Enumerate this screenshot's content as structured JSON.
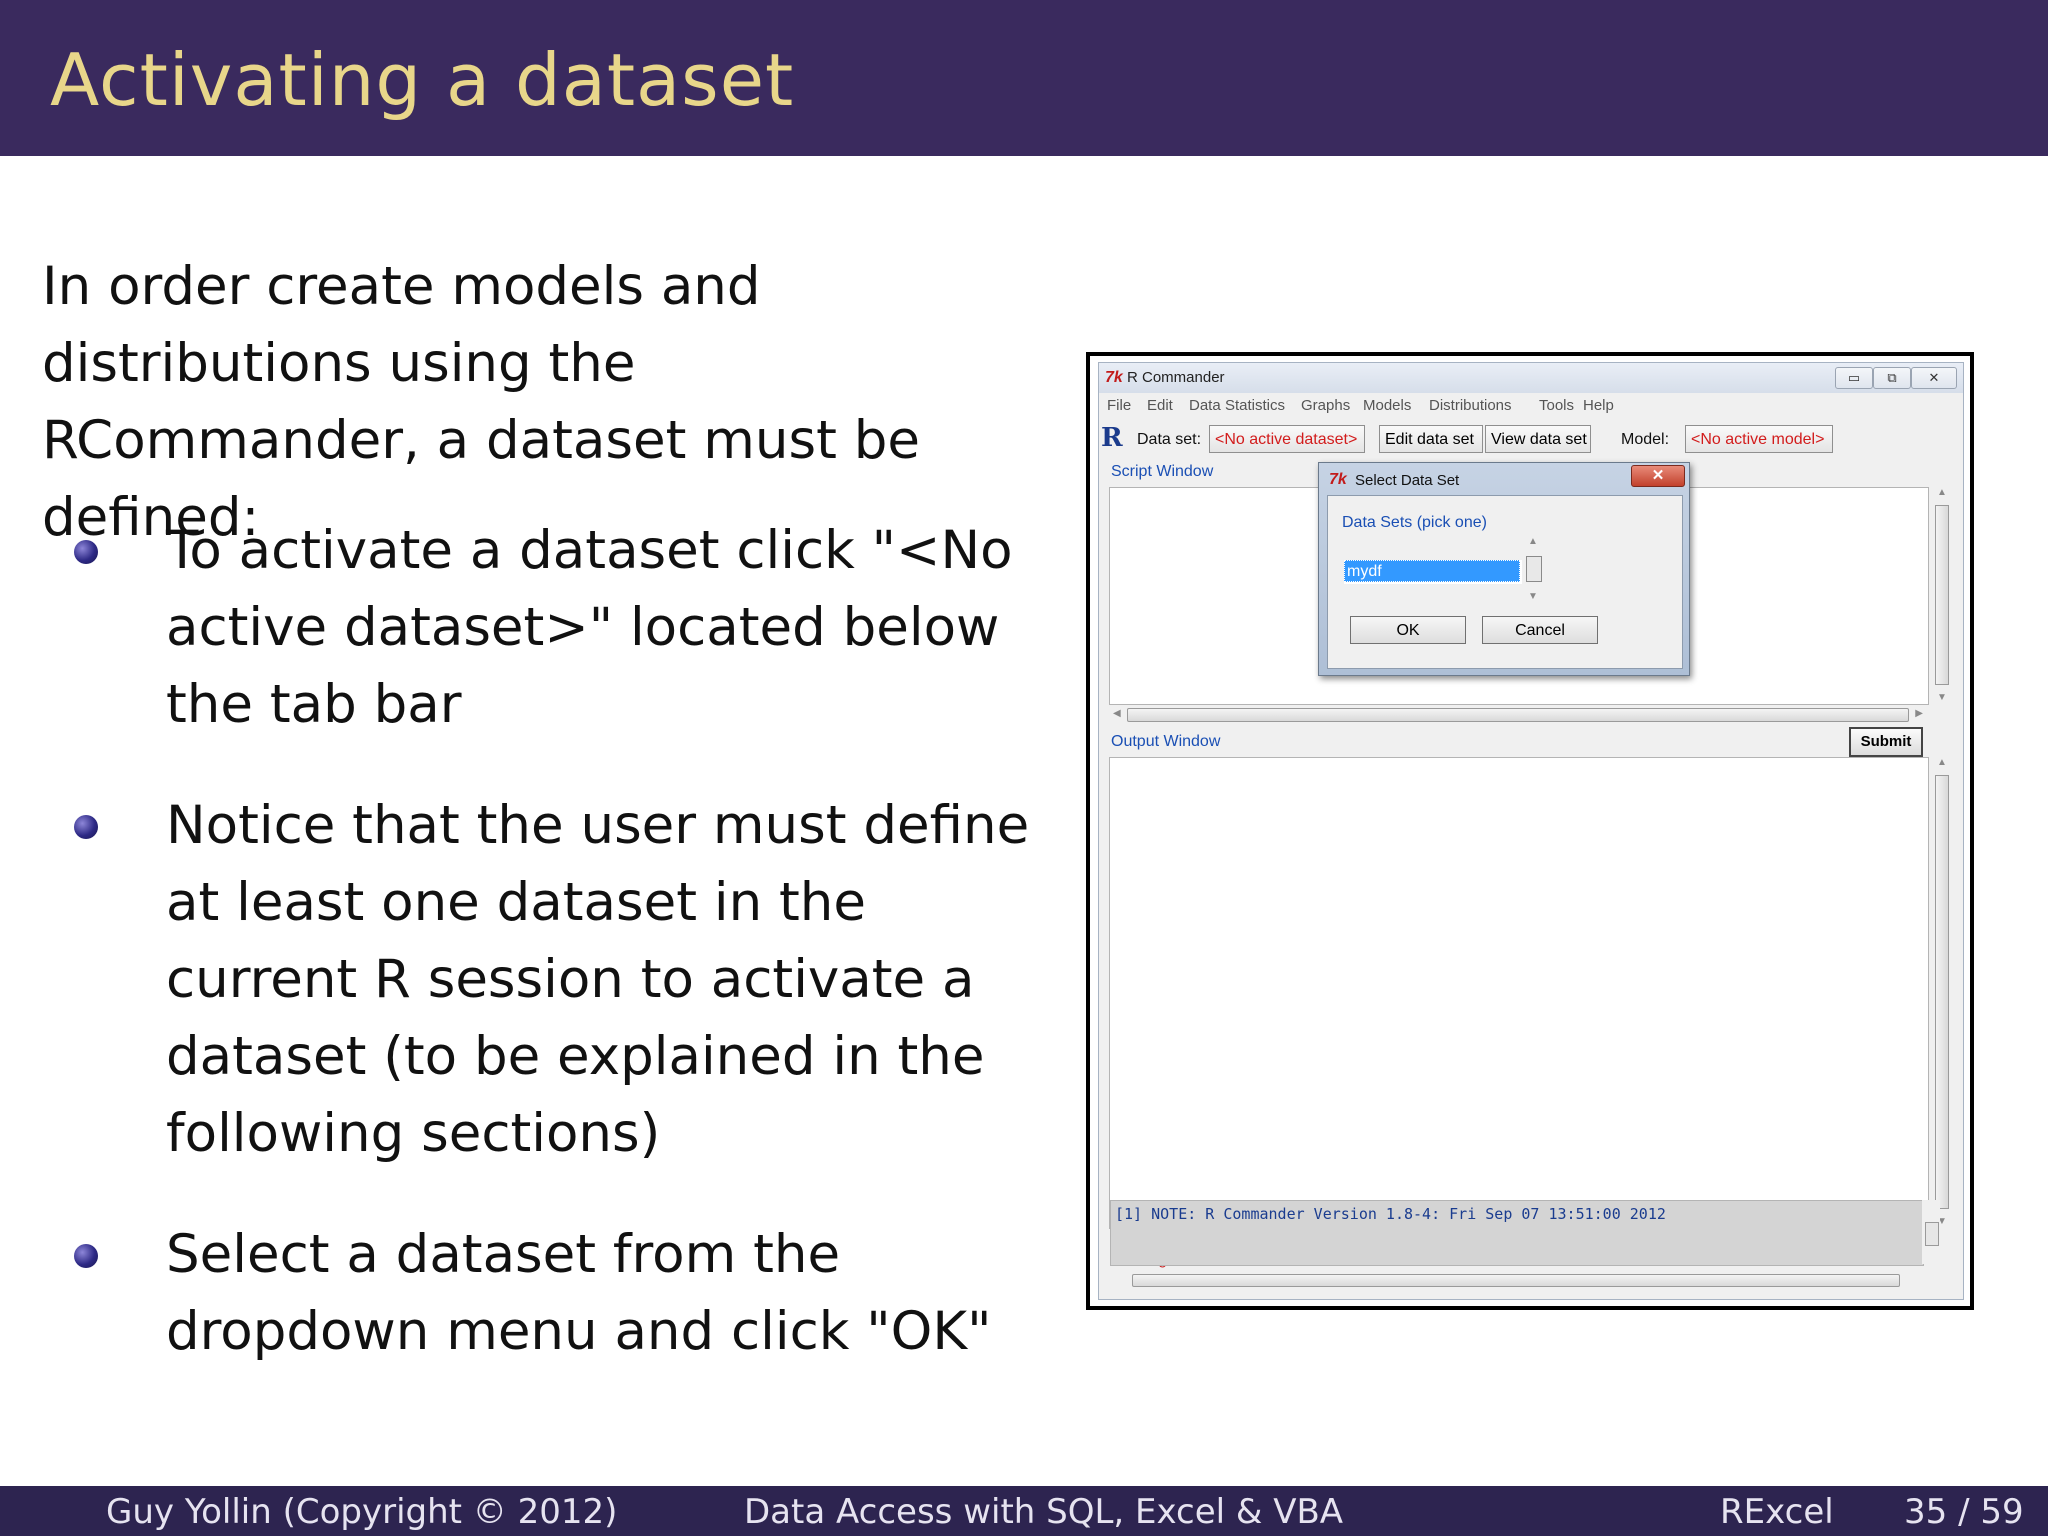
{
  "slide": {
    "title": "Activating a dataset",
    "intro": "In order create models and distributions using the RCommander, a dataset must be defined:",
    "bullets": [
      "To activate a dataset click \"<No active dataset>\" located below the tab bar",
      "Notice that the user must define at least one dataset in the current R session to activate a dataset (to be explained in the following sections)",
      "Select a dataset from the dropdown menu and click \"OK\""
    ]
  },
  "footer": {
    "author": "Guy Yollin  (Copyright © 2012)",
    "course": "Data Access with SQL, Excel & VBA",
    "section": "RExcel",
    "page": "35 / 59"
  },
  "rcmdr": {
    "logo": "7k",
    "title": "R Commander",
    "window_buttons": {
      "minimize": "▭",
      "maximize": "⧉",
      "close": "✕"
    },
    "menu": [
      "File",
      "Edit",
      "Data",
      "Statistics",
      "Graphs",
      "Models",
      "Distributions",
      "Tools",
      "Help"
    ],
    "toolbar": {
      "r_logo": "R",
      "dataset_label": "Data set:",
      "dataset_value": "<No active dataset>",
      "edit_button": "Edit data set",
      "view_button": "View data set",
      "model_label": "Model:",
      "model_value": "<No active model>"
    },
    "script_label": "Script Window",
    "output_label": "Output Window",
    "submit": "Submit",
    "messages_label": "Messages",
    "message_line": "[1] NOTE: R Commander Version 1.8-4: Fri Sep 07 13:51:00 2012",
    "colors": {
      "label_blue": "#1a4fb4",
      "red": "#d21c1c",
      "selection": "#3399ff"
    }
  },
  "dialog": {
    "logo": "7k",
    "title": "Select Data Set",
    "close": "✕",
    "subtitle": "Data Sets (pick one)",
    "options": [
      "mydf"
    ],
    "selected": "mydf",
    "ok": "OK",
    "cancel": "Cancel"
  }
}
